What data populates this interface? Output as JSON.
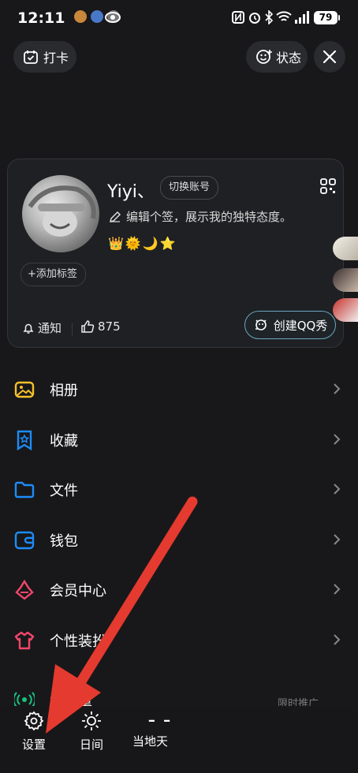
{
  "status_bar": {
    "time": "12:11",
    "battery": "79"
  },
  "top": {
    "checkin_label": "打卡",
    "status_label": "状态"
  },
  "profile": {
    "name": "Yiyi、",
    "switch_account": "切换账号",
    "signature": "编辑个签，展示我的独特态度。",
    "badges": [
      "👑",
      "🌞",
      "🌙",
      "⭐"
    ],
    "add_tag": "添加标签",
    "notify_label": "通知",
    "likes": "875",
    "qq_show": "创建QQ秀"
  },
  "menu": [
    {
      "label": "相册",
      "icon": "album-icon",
      "color": "#f6c12a"
    },
    {
      "label": "收藏",
      "icon": "favorite-icon",
      "color": "#1d8cf8"
    },
    {
      "label": "文件",
      "icon": "folder-icon",
      "color": "#1d8cf8"
    },
    {
      "label": "钱包",
      "icon": "wallet-icon",
      "color": "#1d8cf8"
    },
    {
      "label": "会员中心",
      "icon": "vip-icon",
      "color": "#f2466a"
    },
    {
      "label": "个性装扮",
      "icon": "outfit-icon",
      "color": "#f2466a"
    },
    {
      "label": "免流量",
      "icon": "signal-icon",
      "color": "#19c37d"
    }
  ],
  "menu_partial_right": "限时推广",
  "bottom": {
    "settings": "设置",
    "day_night": "日间",
    "location_label": "当地天气",
    "location_value": "– –"
  },
  "colors": {
    "background": "#18181a",
    "card": "#1f2023",
    "arrow": "#e53a2f",
    "qq_show_border": "#6aa6c2"
  }
}
